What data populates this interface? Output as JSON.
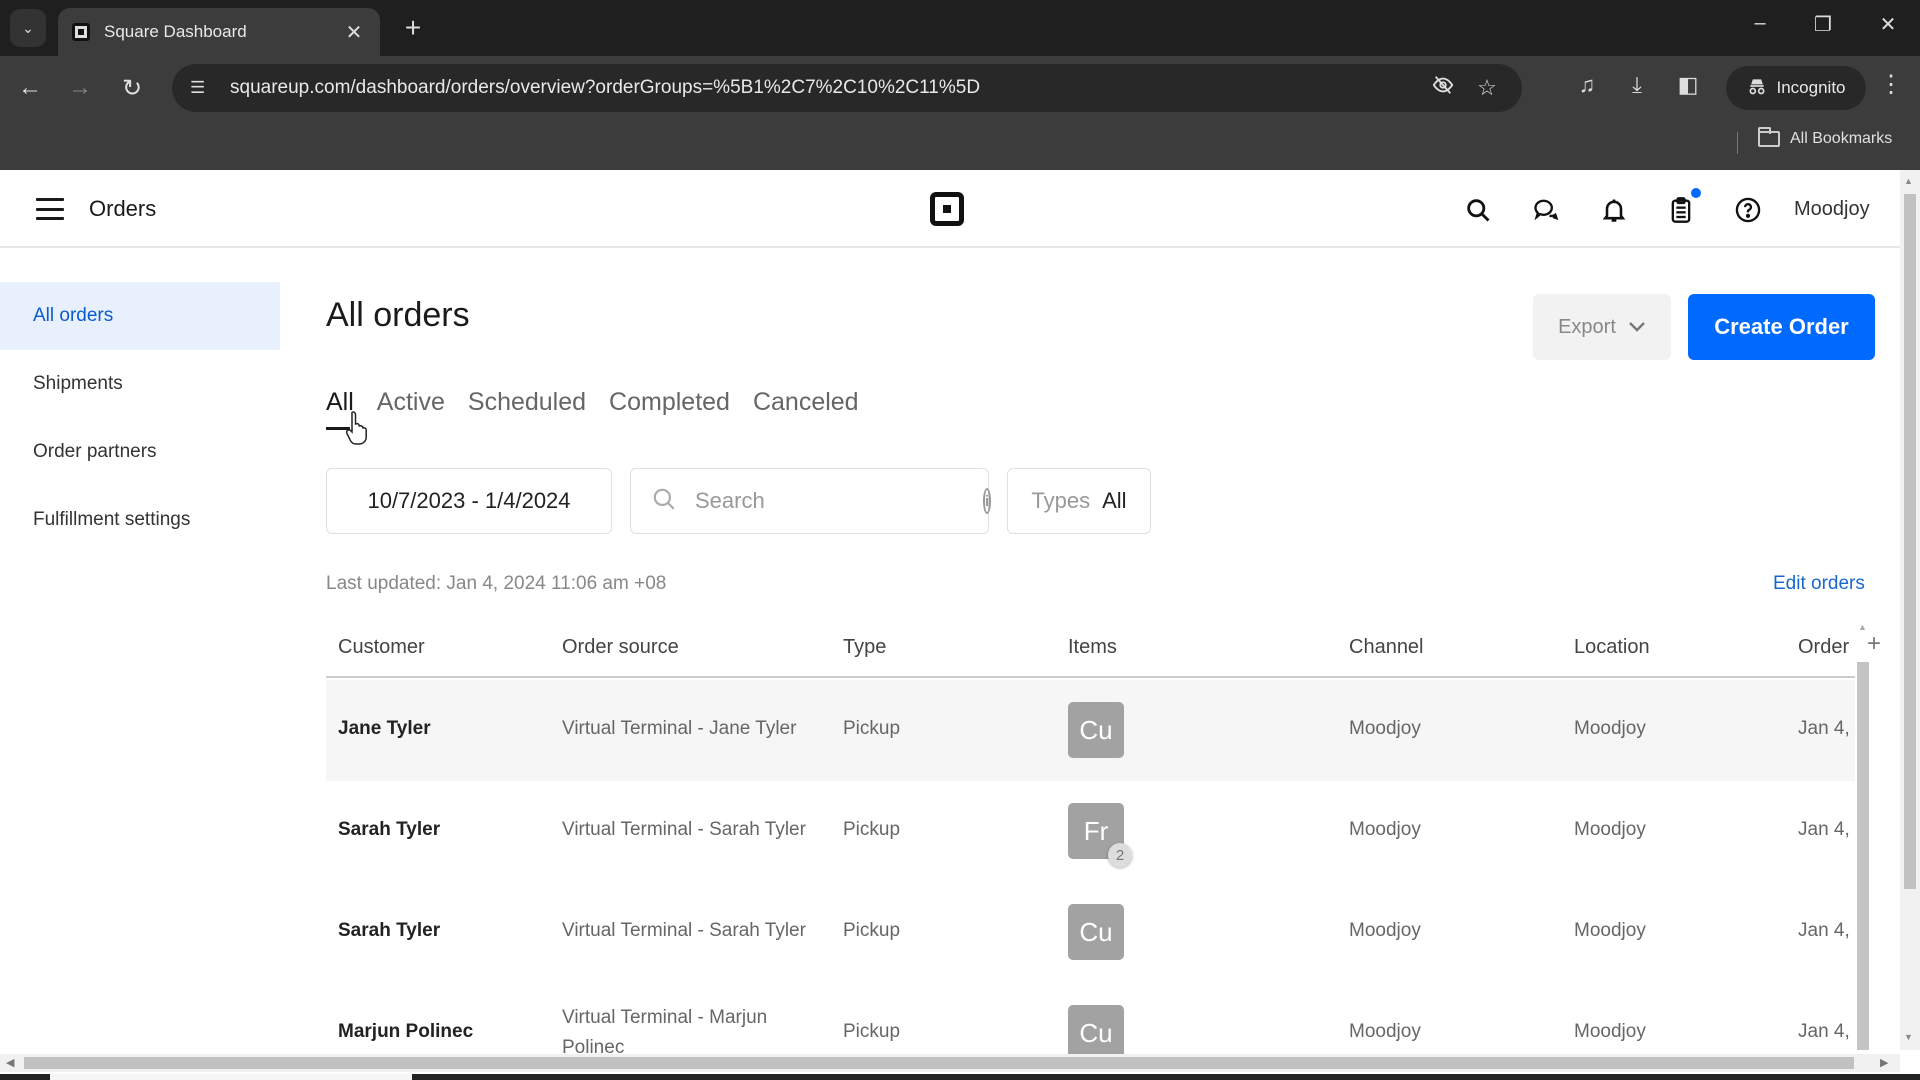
{
  "browser": {
    "tab_title": "Square Dashboard",
    "url": "squareup.com/dashboard/orders/overview?orderGroups=%5B1%2C7%2C10%2C11%5D",
    "profile_label": "Incognito",
    "bookmarks_label": "All Bookmarks",
    "icons": [
      "tab-list-icon",
      "favicon-square",
      "close-icon",
      "plus-icon",
      "minimize-icon",
      "restore-icon",
      "close-window-icon",
      "back-icon",
      "forward-icon",
      "reload-icon",
      "site-info-icon",
      "eye-off-icon",
      "star-icon",
      "media-queue-icon",
      "download-icon",
      "side-panel-icon",
      "incognito-icon",
      "kebab-menu-icon",
      "folder-icon"
    ]
  },
  "header": {
    "title": "Orders",
    "account_name": "Moodjoy",
    "icons": [
      "hamburger-icon",
      "square-logo",
      "search-icon",
      "messages-icon",
      "bell-icon",
      "clipboard-icon",
      "help-icon"
    ],
    "notification_dot_color": "#006aff"
  },
  "sidebar": {
    "items": [
      {
        "label": "All orders",
        "active": true
      },
      {
        "label": "Shipments",
        "active": false
      },
      {
        "label": "Order partners",
        "active": false
      },
      {
        "label": "Fulfillment settings",
        "active": false
      }
    ]
  },
  "main": {
    "title": "All orders",
    "export_label": "Export",
    "create_label": "Create Order",
    "accent_color": "#006aff",
    "tabs": [
      {
        "label": "All",
        "active": true
      },
      {
        "label": "Active",
        "active": false
      },
      {
        "label": "Scheduled",
        "active": false
      },
      {
        "label": "Completed",
        "active": false
      },
      {
        "label": "Canceled",
        "active": false
      }
    ],
    "filters": {
      "date_range": "10/7/2023 - 1/4/2024",
      "search_placeholder": "Search",
      "search_value": "",
      "types_label": "Types",
      "types_value": "All"
    },
    "last_updated": "Last updated: Jan 4, 2024 11:06 am +08",
    "edit_orders_label": "Edit orders"
  },
  "table": {
    "columns": [
      "Customer",
      "Order source",
      "Type",
      "Items",
      "Channel",
      "Location",
      "Order"
    ],
    "rows": [
      {
        "customer": "Jane Tyler",
        "source": "Virtual Terminal - Jane Tyler",
        "type": "Pickup",
        "item_abbr": "Cu",
        "item_count": "",
        "channel": "Moodjoy",
        "location": "Moodjoy",
        "order_date": "Jan 4,"
      },
      {
        "customer": "Sarah Tyler",
        "source": "Virtual Terminal - Sarah Tyler",
        "type": "Pickup",
        "item_abbr": "Fr",
        "item_count": "2",
        "channel": "Moodjoy",
        "location": "Moodjoy",
        "order_date": "Jan 4,"
      },
      {
        "customer": "Sarah Tyler",
        "source": "Virtual Terminal - Sarah Tyler",
        "type": "Pickup",
        "item_abbr": "Cu",
        "item_count": "",
        "channel": "Moodjoy",
        "location": "Moodjoy",
        "order_date": "Jan 4,"
      },
      {
        "customer": "Marjun Polinec",
        "source": "Virtual Terminal - Marjun Polinec",
        "type": "Pickup",
        "item_abbr": "Cu",
        "item_count": "",
        "channel": "Moodjoy",
        "location": "Moodjoy",
        "order_date": "Jan 4,"
      }
    ]
  }
}
